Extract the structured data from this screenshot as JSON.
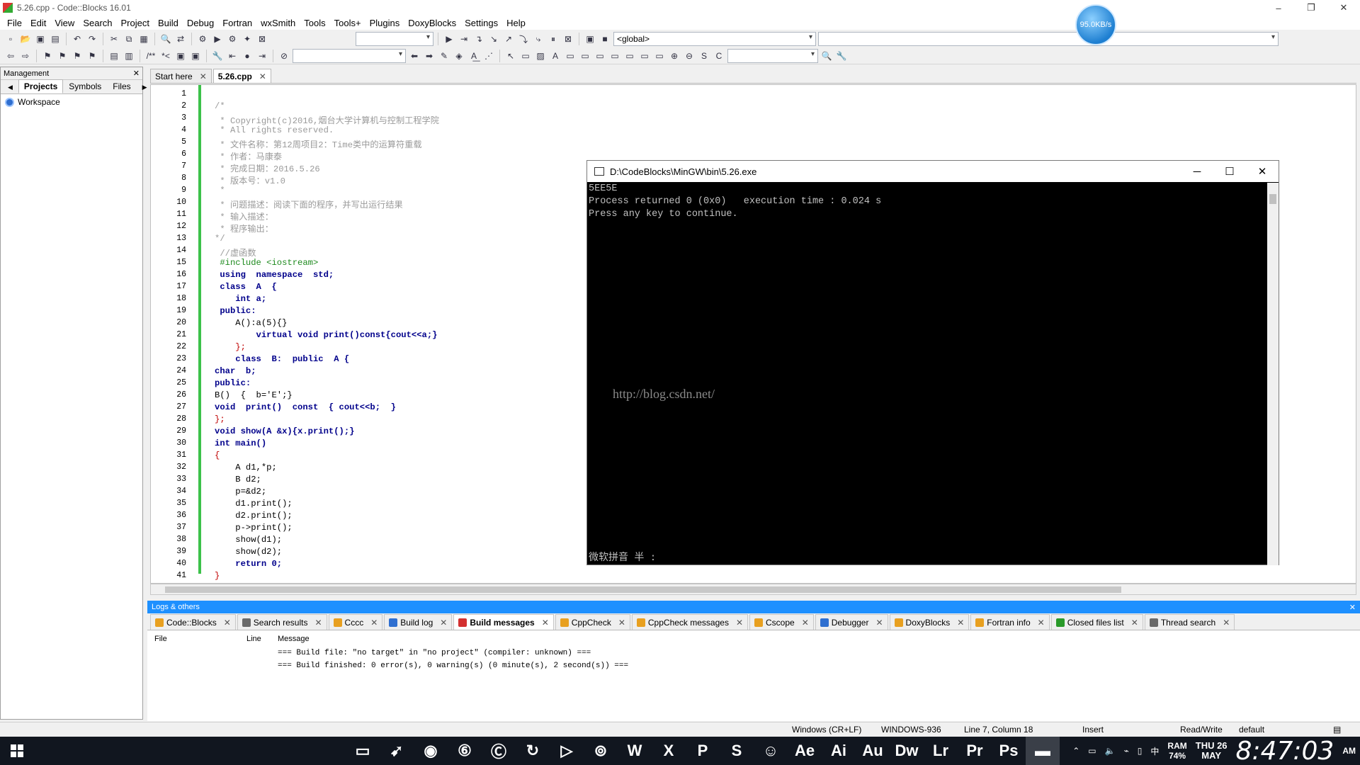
{
  "window": {
    "title": "5.26.cpp - Code::Blocks 16.01",
    "minimize": "–",
    "maximize": "❐",
    "close": "✕"
  },
  "speed_badge": "95.0KB/s",
  "menu": [
    "File",
    "Edit",
    "View",
    "Search",
    "Project",
    "Build",
    "Debug",
    "Fortran",
    "wxSmith",
    "Tools",
    "Tools+",
    "Plugins",
    "DoxyBlocks",
    "Settings",
    "Help"
  ],
  "toolbar": {
    "scope_combo": "<global>",
    "search_combo": "",
    "jump_combo": ""
  },
  "management": {
    "title": "Management",
    "close": "✕",
    "tabs": [
      "Projects",
      "Symbols",
      "Files"
    ],
    "tree_root": "Workspace"
  },
  "editor": {
    "tabs": [
      {
        "label": "Start here",
        "close": "✕"
      },
      {
        "label": "5.26.cpp",
        "close": "✕"
      }
    ],
    "lines": [
      "",
      "/*",
      " * Copyright(c)2016,烟台大学计算机与控制工程学院",
      " * All rights reserved.",
      " * 文件名称：第12周项目2：Time类中的运算符重载",
      " * 作者：马康泰",
      " * 完成日期：2016.5.26",
      " * 版本号：v1.0",
      " *",
      " * 问题描述：阅读下面的程序，并写出运行结果",
      " * 输入描述：",
      " * 程序输出：",
      "*/",
      " //虚函数",
      " #include <iostream>",
      " using  namespace  std;",
      " class  A  {",
      "    int a;",
      " public:",
      "    A():a(5){}",
      "        virtual void print()const{cout<<a;}",
      "    };",
      "    class  B:  public  A {",
      "char  b;",
      "public:",
      "B()  {  b='E';}",
      "void  print()  const  { cout<<b;  }",
      "};",
      "void show(A &x){x.print();}",
      "int main()",
      "{",
      "    A d1,*p;",
      "    B d2;",
      "    p=&d2;",
      "    d1.print();",
      "    d2.print();",
      "    p->print();",
      "    show(d1);",
      "    show(d2);",
      "    return 0;",
      "}"
    ]
  },
  "console": {
    "title": "D:\\CodeBlocks\\MinGW\\bin\\5.26.exe",
    "minimize": "─",
    "maximize": "☐",
    "close": "✕",
    "output": [
      "5EE5E",
      "Process returned 0 (0x0)   execution time : 0.024 s",
      "Press any key to continue."
    ],
    "watermark": "http://blog.csdn.net/",
    "ime": "微软拼音 半 :"
  },
  "logs": {
    "title": "Logs & others",
    "close": "✕",
    "tabs": [
      {
        "label": "Code::Blocks",
        "color": "#e8a020"
      },
      {
        "label": "Search results",
        "color": "#6a6a6a"
      },
      {
        "label": "Cccc",
        "color": "#e8a020"
      },
      {
        "label": "Build log",
        "color": "#2f6fd0"
      },
      {
        "label": "Build messages",
        "color": "#d33030"
      },
      {
        "label": "CppCheck",
        "color": "#e8a020"
      },
      {
        "label": "CppCheck messages",
        "color": "#e8a020"
      },
      {
        "label": "Cscope",
        "color": "#e8a020"
      },
      {
        "label": "Debugger",
        "color": "#2f6fd0"
      },
      {
        "label": "DoxyBlocks",
        "color": "#e8a020"
      },
      {
        "label": "Fortran info",
        "color": "#e8a020"
      },
      {
        "label": "Closed files list",
        "color": "#2a9a2a"
      },
      {
        "label": "Thread search",
        "color": "#6a6a6a"
      }
    ],
    "active_tab": 4,
    "columns": [
      "File",
      "Line",
      "Message"
    ],
    "messages": [
      "=== Build file: \"no target\" in \"no project\" (compiler: unknown) ===",
      "=== Build finished: 0 error(s), 0 warning(s) (0 minute(s), 2 second(s)) ==="
    ]
  },
  "status": {
    "eol": "Windows (CR+LF)",
    "encoding": "WINDOWS-936",
    "position": "Line 7, Column 18",
    "mode": "Insert",
    "access": "Read/Write",
    "profile": "default"
  },
  "taskbar": {
    "apps": [
      "file-explorer",
      "browser",
      "qq",
      "music",
      "cloud",
      "360",
      "player",
      "game",
      "word",
      "excel",
      "powerpoint",
      "s-app",
      "chat",
      "Ae",
      "Ai",
      "Au",
      "Dw",
      "Lr",
      "Pr",
      "Ps",
      "console"
    ],
    "app_labels": [
      "▭",
      "➹",
      "◉",
      "⑥",
      "Ⓒ",
      "↻",
      "▷",
      "⊚",
      "W",
      "X",
      "P",
      "S",
      "☺",
      "Ae",
      "Ai",
      "Au",
      "Dw",
      "Lr",
      "Pr",
      "Ps",
      "▬"
    ],
    "ram_label": "RAM",
    "ram_value": "74%",
    "day": "THU 26",
    "month": "MAY",
    "time": "8:47:03",
    "ampm": "AM",
    "ime": "中"
  }
}
